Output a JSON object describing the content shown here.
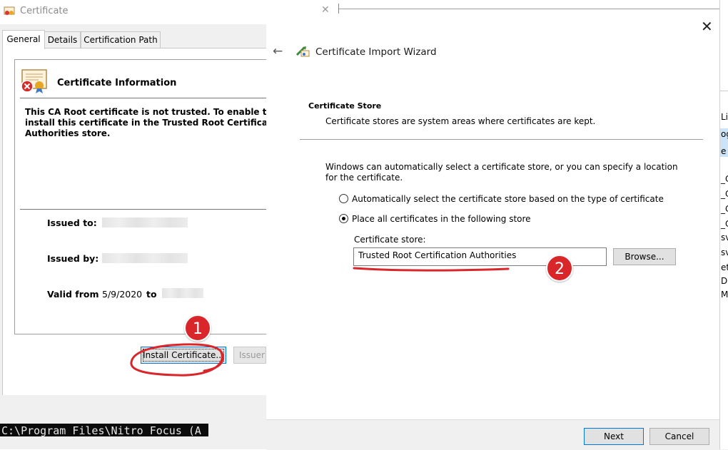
{
  "cert_dialog": {
    "title": "Certificate",
    "tabs": [
      "General",
      "Details",
      "Certification Path"
    ],
    "info_heading": "Certificate Information",
    "warning": "This CA Root certificate is not trusted. To enable tr\ninstall this certificate in the Trusted Root Certificat\nAuthorities store.",
    "issued_to_label": "Issued to:",
    "issued_by_label": "Issued by:",
    "valid_from_label": "Valid from",
    "valid_from_value": "5/9/2020",
    "valid_to_label": "to",
    "install_button": "Install Certificate...",
    "issuer_button": "Issuer",
    "terminal_text": "C:\\Program Files\\Nitro Focus (A"
  },
  "wizard": {
    "title": "Certificate Import Wizard",
    "section_heading": "Certificate Store",
    "section_desc": "Certificate stores are system areas where certificates are kept.",
    "auto_text": "Windows can automatically select a certificate store, or you can specify a location for the certificate.",
    "radio_auto_label": "Automatically select the certificate store based on the type of certificate",
    "radio_place_label": "Place all certificates in the following store",
    "selected_option": "Place all certificates in the following store",
    "store_label": "Certificate store:",
    "store_value": "Trusted Root Certification Authorities",
    "browse_button": "Browse...",
    "next_button": "Next",
    "cancel_button": "Cancel"
  },
  "background_window": {
    "fragments": [
      "Li",
      "og",
      "e",
      "_C",
      "_C",
      "_C",
      "_C",
      "sv",
      "sv",
      "et_",
      "D",
      "M"
    ]
  },
  "annotations": {
    "badge_1": "1",
    "badge_2": "2",
    "highlight_color": "#d9262a"
  }
}
